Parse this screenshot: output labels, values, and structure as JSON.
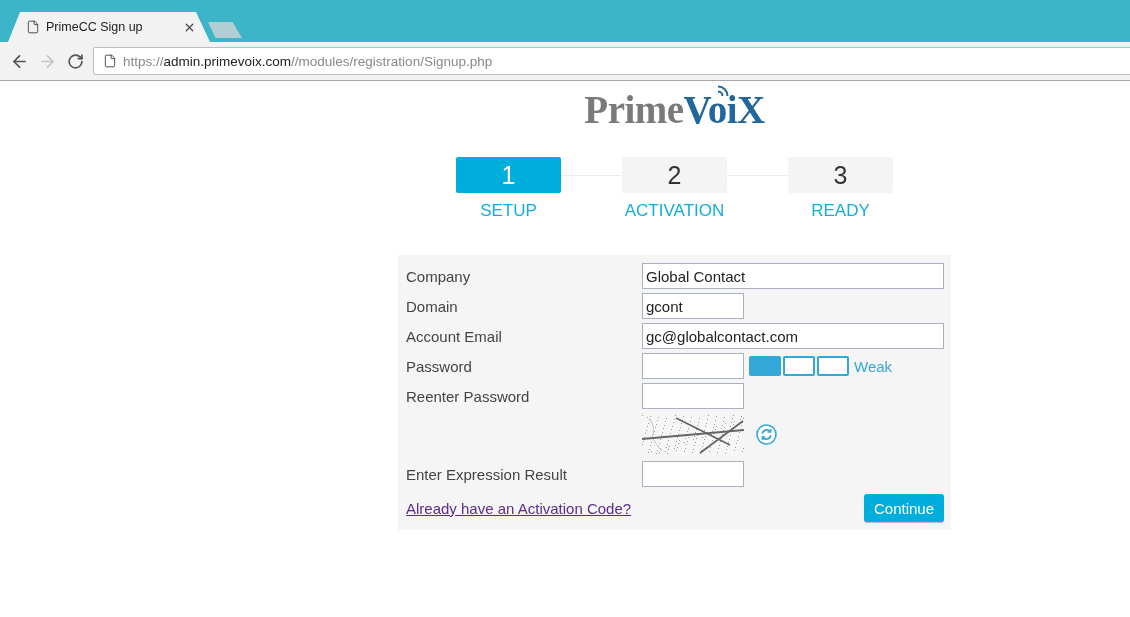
{
  "browser": {
    "tab": {
      "title": "PrimeCC Sign up"
    },
    "back": {
      "disabled": false
    },
    "forward": {
      "disabled": true
    },
    "address": {
      "scheme": "https://",
      "host": "admin.primevoix.com",
      "path": "//modules/registration/Signup.php"
    }
  },
  "logo": {
    "first": "Prime",
    "second": "VoiX"
  },
  "steps": [
    {
      "number": "1",
      "label": "SETUP",
      "selected": true
    },
    {
      "number": "2",
      "label": "ACTIVATION",
      "selected": false
    },
    {
      "number": "3",
      "label": "READY",
      "selected": false
    }
  ],
  "form": {
    "rows": [
      {
        "kind": "wide",
        "label": "Company",
        "value": "Global Contact"
      },
      {
        "kind": "short",
        "label": "Domain",
        "value": "gcont"
      },
      {
        "kind": "wide",
        "label": "Account Email",
        "value": "gc@globalcontact.com"
      },
      {
        "kind": "password",
        "label": "Password",
        "strength": {
          "segments": [
            {
              "filled": true
            },
            {
              "filled": false
            },
            {
              "filled": false
            }
          ],
          "label": "Weak"
        }
      },
      {
        "kind": "short",
        "label": "Reenter Password"
      },
      {
        "kind": "captcha"
      },
      {
        "kind": "short",
        "label": "Enter Expression Result"
      }
    ],
    "link": "Already have an Activation Code?",
    "submit": "Continue"
  }
}
